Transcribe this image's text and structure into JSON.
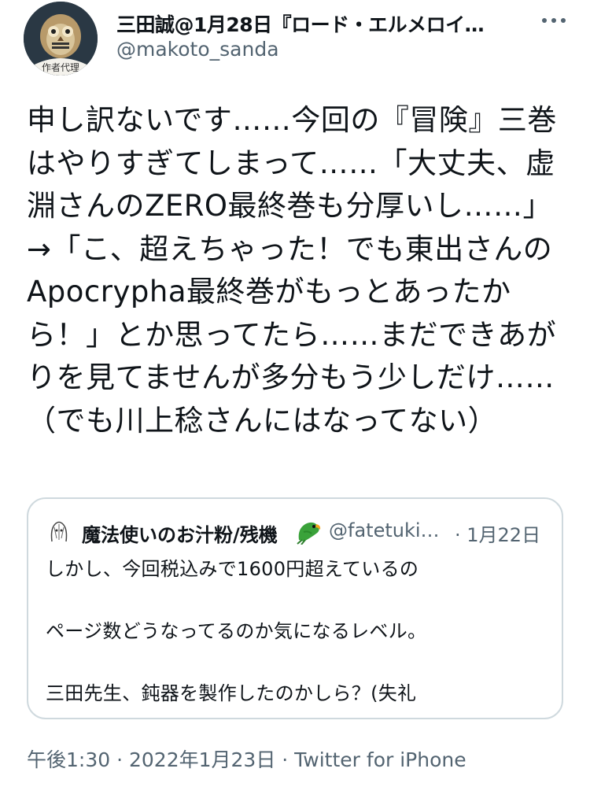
{
  "author": {
    "display_name": "三田誠@1月28日『ロード・エルメロイ…",
    "handle": "@makoto_sanda",
    "avatar_caption": "作者代理"
  },
  "tweet": {
    "text": "申し訳ないです……今回の『冒険』三巻はやりすぎてしまって……「大丈夫、虚淵さんのZERO最終巻も分厚いし……」→「こ、超えちゃった！でも東出さんのApocrypha最終巻がもっとあったから！」とか思ってたら……まだできあがりを見てませんが多分もう少しだけ……（でも川上稔さんにはなってない）"
  },
  "quote": {
    "display_name": "魔法使いのお汁粉/残機",
    "handle": "@fatetuki…",
    "date": "· 1月22日",
    "lines": [
      "しかし、今回税込みで1600円超えているの",
      "",
      "ページ数どうなってるのか気になるレベル。",
      "",
      "三田先生、鈍器を製作したのかしら？(失礼"
    ]
  },
  "meta": {
    "timestamp": "午後1:30 · 2022年1月23日 · Twitter for iPhone"
  },
  "icons": {
    "more": "more-horizontal-icon",
    "quote_emoji": "parrot-icon"
  },
  "colors": {
    "text": "#0f1419",
    "secondary": "#536471",
    "border": "#cfd9de",
    "parrot_green": "#3aa23a"
  }
}
